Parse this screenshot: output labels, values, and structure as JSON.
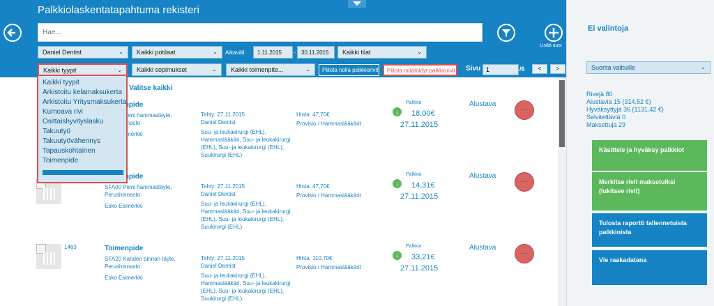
{
  "header": {
    "title": "Palkkiolaskentatapahtuma rekisteri",
    "add_label": "Lisää uusi",
    "search_placeholder": "Hae..."
  },
  "filters": {
    "dentist": "Daniel Dentist",
    "patients": "Kaikki potilaat",
    "period_label": "Aikaväli:",
    "date_from": "1.11.2015",
    "date_sep": "-",
    "date_to": "30.11.2015",
    "states": "Kaikki tilat",
    "types": "Kaikki tyypit",
    "agreements": "Kaikki sopimukset",
    "procedures": "Kaikki toimenpite...",
    "hide_zero": "Piilota nolla palkkiorivit",
    "hide_invalid": "Piilota mitätöidyt palkkiorivit",
    "page_label": "Sivu",
    "page_value": "1",
    "page_total": "/6",
    "prev": "<",
    "next": ">"
  },
  "select_all": "Valitse kaikki",
  "type_dropdown": [
    "Kaikki tyypit",
    "Arkistoitu kelamaksukerta",
    "Arkistoitu Yritysmaksukerta",
    "Kumoava rivi",
    "Osittaishyvityslasku",
    "Takuutyö",
    "Takuutyövähennys",
    "Tapauskohtainen",
    "Toimenpide"
  ],
  "rows": [
    {
      "id": "",
      "title": "Toimenpide",
      "code": "SFA00 Pieni hammastäyte, Perushinnasto",
      "person": "Esko Esimerkki",
      "date": "Tehty: 27.11.2015",
      "doctor": "Daniel Dentist",
      "description": "Suu- ja leukakirurgi (EHL), Hammaslääkäri, Suu- ja leukakirurgi (EHL), Suu- ja leukakirurgi (EHL), Suukirurgi (EHL)",
      "price": "Hinta: 47,70€",
      "provision": "Provisio / Hammaslääkärit",
      "fee_label": "Palkkio",
      "fee_amount": "18,00€",
      "fee_date": "27.11.2015",
      "status": "Alustava",
      "more": "···"
    },
    {
      "id": "",
      "title": "Toimenpide",
      "code": "SFA00 Pieni hammastäyte, Perushinnasto",
      "person": "Esko Esimerkki",
      "date": "Tehty: 27.11.2015",
      "doctor": "Daniel Dentist",
      "description": "Suu- ja leukakirurgi (EHL), Hammaslääkäri, Suu- ja leukakirurgi (EHL), Suu- ja leukakirurgi (EHL), Suukirurgi (EHL)",
      "price": "Hinta: 47,70€",
      "provision": "Provisio / Hammaslääkärit",
      "fee_label": "Palkkio",
      "fee_amount": "14,31€",
      "fee_date": "27.11.2015",
      "status": "Alustava",
      "more": "···"
    },
    {
      "id": "1463",
      "title": "Toimenpide",
      "code": "SFA20 Kahden pinnan täyte, Perushinnasto",
      "person": "Esko Esimerkki",
      "date": "Tehty: 27.11.2015",
      "doctor": "Daniel Dentist",
      "description": "Suu- ja leukakirurgi (EHL), Hammaslääkäri, Suu- ja leukakirurgi (EHL), Suu- ja leukakirurgi (EHL), Suukirurgi (EHL)",
      "price": "Hinta: 110,70€",
      "provision": "Provisio / Hammaslääkärit",
      "fee_label": "Palkkio",
      "fee_amount": "33,21€",
      "fee_date": "27.11.2015",
      "status": "Alustava",
      "more": "···"
    }
  ],
  "right_panel": {
    "title": "Ei valintoja",
    "bulk_action": "Suorita valituille",
    "stats": [
      "Rivejä 80",
      "Alustavia 15 (314,52 €)",
      "Hyväksyttyjä 36 (1131,42 €)",
      "Selvitettäviä 0",
      "Maksettuja 29"
    ],
    "actions": [
      "Käsittele ja hyväksy palkkiot",
      "Merkitse rivit maksetuiksi (lukitsee rivit)",
      "Tulosta raportti tallennetuista palkkioista",
      "Vie raakadatana"
    ]
  },
  "colors": {
    "primary": "#1583c4",
    "green": "#5bb95b",
    "red": "#e05050"
  }
}
